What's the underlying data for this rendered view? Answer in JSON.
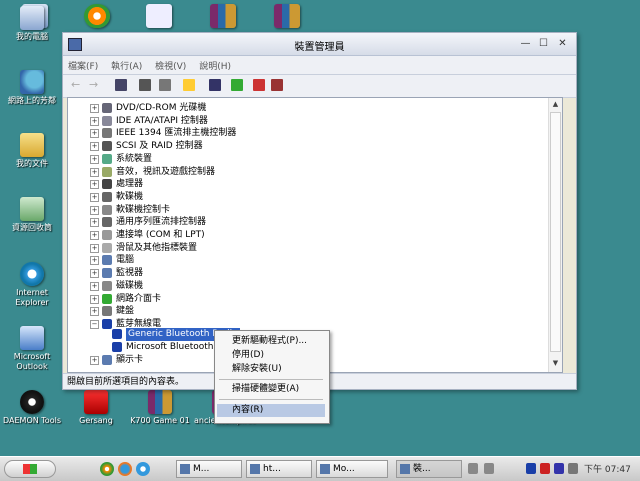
{
  "desktop": {
    "icons": [
      {
        "label": "我的電腦",
        "icon": "my-computer-icon"
      },
      {
        "label": "網路上的芳鄰",
        "icon": "network-places-icon"
      },
      {
        "label": "我的文件",
        "icon": "my-documents-icon"
      },
      {
        "label": "資源回收筒",
        "icon": "recycle-bin-icon"
      },
      {
        "label": "Internet Explorer",
        "icon": "internet-explorer-icon"
      },
      {
        "label": "Microsoft Outlook",
        "icon": "outlook-icon"
      },
      {
        "label": "DAEMON Tools",
        "icon": "daemon-tools-icon"
      },
      {
        "label": "Gersang",
        "icon": "gersang-icon"
      },
      {
        "label": "K700 Game 01",
        "icon": "winrar-archive-icon"
      },
      {
        "label": "ancientempires",
        "icon": "winrar-archive-icon"
      }
    ]
  },
  "window": {
    "title": "裝置管理員",
    "menu": [
      "檔案(F)",
      "執行(A)",
      "檢視(V)",
      "說明(H)"
    ],
    "tree": [
      {
        "label": "DVD/CD-ROM 光碟機",
        "icon": "cdrom-icon"
      },
      {
        "label": "IDE ATA/ATAPI 控制器",
        "icon": "ide-icon"
      },
      {
        "label": "IEEE 1394 匯流排主機控制器",
        "icon": "ieee1394-icon"
      },
      {
        "label": "SCSI 及 RAID 控制器",
        "icon": "scsi-icon"
      },
      {
        "label": "系統裝置",
        "icon": "system-device-icon"
      },
      {
        "label": "音效，視訊及遊戲控制器",
        "icon": "sound-icon"
      },
      {
        "label": "處理器",
        "icon": "processor-icon"
      },
      {
        "label": "軟碟機",
        "icon": "floppy-icon"
      },
      {
        "label": "軟碟機控制卡",
        "icon": "floppy-controller-icon"
      },
      {
        "label": "通用序列匯流排控制器",
        "icon": "usb-icon"
      },
      {
        "label": "連接埠 (COM 和 LPT)",
        "icon": "port-icon"
      },
      {
        "label": "滑鼠及其他指標裝置",
        "icon": "mouse-icon"
      },
      {
        "label": "電腦",
        "icon": "computer-icon"
      },
      {
        "label": "監視器",
        "icon": "monitor-icon"
      },
      {
        "label": "磁碟機",
        "icon": "disk-icon"
      },
      {
        "label": "網路介面卡",
        "icon": "network-adapter-icon"
      },
      {
        "label": "鍵盤",
        "icon": "keyboard-icon"
      },
      {
        "label": "藍芽無線電",
        "icon": "bluetooth-icon"
      }
    ],
    "bluetooth_children": [
      "Generic Bluetooth Radio",
      "Microsoft Bluetooth Enumerator"
    ],
    "last_node": "顯示卡",
    "status": "開啟目前所選項目的內容表。"
  },
  "context_menu": {
    "items": [
      "更新驅動程式(P)...",
      "停用(D)",
      "解除安裝(U)",
      "掃描硬體變更(A)",
      "內容(R)"
    ]
  },
  "taskbar": {
    "tasks": [
      "M...",
      "ht...",
      "Mo...",
      "裝..."
    ],
    "clock": "下午 07:47"
  }
}
